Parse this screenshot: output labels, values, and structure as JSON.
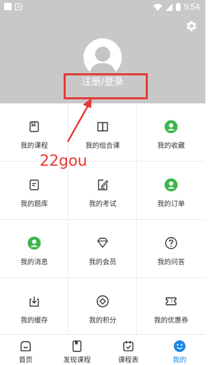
{
  "status_bar": {
    "time": "9:54"
  },
  "header": {
    "login_label": "注册/登录"
  },
  "annotation": {
    "text": "22gou"
  },
  "menu": [
    {
      "label": "我的课程",
      "icon": "book-icon"
    },
    {
      "label": "我的组合课",
      "icon": "open-book-icon"
    },
    {
      "label": "我的收藏",
      "icon": "user-green-icon"
    },
    {
      "label": "我的题库",
      "icon": "document-icon"
    },
    {
      "label": "我的考试",
      "icon": "edit-paper-icon"
    },
    {
      "label": "我的订单",
      "icon": "user-green-icon"
    },
    {
      "label": "我的消息",
      "icon": "user-green-icon"
    },
    {
      "label": "我的会员",
      "icon": "diamond-icon"
    },
    {
      "label": "我的问答",
      "icon": "question-icon"
    },
    {
      "label": "我的缓存",
      "icon": "download-icon"
    },
    {
      "label": "我的积分",
      "icon": "coin-icon"
    },
    {
      "label": "我的优惠券",
      "icon": "ticket-icon"
    }
  ],
  "tabbar": [
    {
      "label": "首页",
      "icon": "home-icon"
    },
    {
      "label": "发现课程",
      "icon": "discover-icon"
    },
    {
      "label": "课程表",
      "icon": "calendar-icon"
    },
    {
      "label": "我的",
      "icon": "smiley-icon",
      "active": true
    }
  ],
  "colors": {
    "accent": "#1e88e5",
    "green": "#3bb54a",
    "annotation": "#e53935",
    "header_bg": "#c8c8c8"
  }
}
